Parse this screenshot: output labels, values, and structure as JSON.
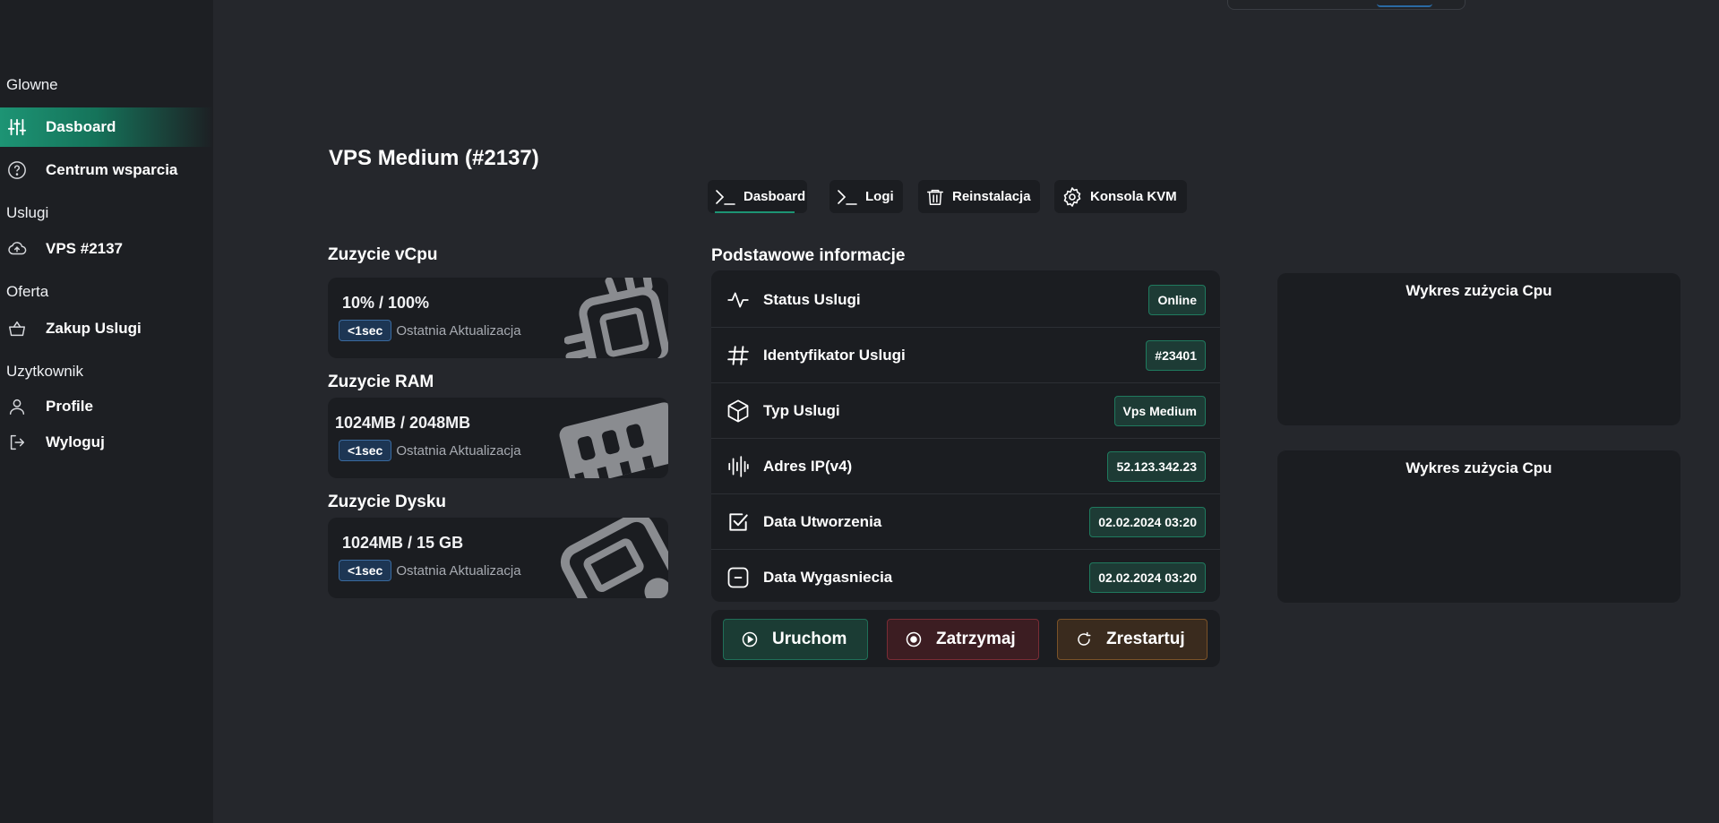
{
  "sidebar": {
    "sections": {
      "main": "Glowne",
      "services": "Uslugi",
      "offer": "Oferta",
      "user": "Uzytkownik"
    },
    "items": {
      "dashboard": "Dasboard",
      "support": "Centrum wsparcia",
      "vps": "VPS #2137",
      "buy": "Zakup Uslugi",
      "profile": "Profile",
      "logout": "Wyloguj"
    }
  },
  "page": {
    "title": "VPS Medium (#2137)"
  },
  "tabs": {
    "dashboard": "Dasboard",
    "logs": "Logi",
    "reinstall": "Reinstalacja",
    "kvm": "Konsola KVM"
  },
  "usage": {
    "cpu": {
      "title": "Zuzycie vCpu",
      "value": "10% / 100%",
      "badge": "<1sec",
      "meta": "Ostatnia Aktualizacja"
    },
    "ram": {
      "title": "Zuzycie RAM",
      "value": "1024MB / 2048MB",
      "badge": "<1sec",
      "meta": "Ostatnia Aktualizacja"
    },
    "disk": {
      "title": "Zuzycie Dysku",
      "value": "1024MB / 15 GB",
      "badge": "<1sec",
      "meta": "Ostatnia Aktualizacja"
    }
  },
  "info": {
    "title": "Podstawowe informacje",
    "rows": [
      {
        "label": "Status Uslugi",
        "value": "Online",
        "icon": "activity-icon"
      },
      {
        "label": "Identyfikator Uslugi",
        "value": "#23401",
        "icon": "hash-icon"
      },
      {
        "label": "Typ Uslugi",
        "value": "Vps Medium",
        "icon": "box-icon"
      },
      {
        "label": "Adres IP(v4)",
        "value": "52.123.342.23",
        "icon": "audio-lines-icon"
      },
      {
        "label": "Data Utworzenia",
        "value": "02.02.2024 03:20",
        "icon": "checkbox-icon"
      },
      {
        "label": "Data Wygasniecia",
        "value": "02.02.2024 03:20",
        "icon": "minus-square-icon"
      }
    ]
  },
  "actions": {
    "start": "Uruchom",
    "stop": "Zatrzymaj",
    "restart": "Zrestartuj"
  },
  "charts": {
    "cpu1": "Wykres zużycia Cpu",
    "cpu2": "Wykres zużycia Cpu"
  },
  "colors": {
    "accent": "#1d9474",
    "background": "#25272c",
    "panel": "#1b1d21",
    "start": "#1b3c34",
    "stop": "#3c1d22",
    "restart": "#3a2b1e"
  }
}
